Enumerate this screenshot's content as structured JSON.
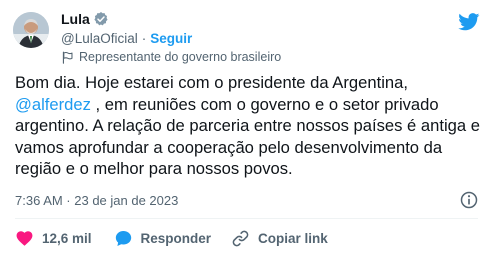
{
  "author": {
    "display_name": "Lula",
    "handle": "@LulaOficial",
    "follow_label": "Seguir",
    "separator": "·",
    "label": "Representante do governo brasileiro"
  },
  "tweet": {
    "text_before": "Bom dia. Hoje estarei com o presidente da Argentina, ",
    "mention": "@alferdez",
    "text_after": " , em reuniões com o governo e o setor privado argentino. A relação de parceria entre nossos países é antiga e vamos aprofundar a cooperação pelo desenvolvimento da região e o melhor para nossos povos.",
    "timestamp": "7:36 AM · 23 de jan de 2023"
  },
  "actions": {
    "like_count": "12,6 mil",
    "reply_label": "Responder",
    "copy_link_label": "Copiar link"
  },
  "colors": {
    "accent": "#1d9bf0",
    "like": "#f91880",
    "text": "#0f1419",
    "muted": "#536471"
  },
  "icons": {
    "verified": "verified-badge-icon",
    "platform": "twitter-bird-icon",
    "government": "government-flag-icon",
    "info": "info-icon",
    "like": "heart-icon",
    "reply": "speech-bubble-icon",
    "copy": "link-icon"
  }
}
